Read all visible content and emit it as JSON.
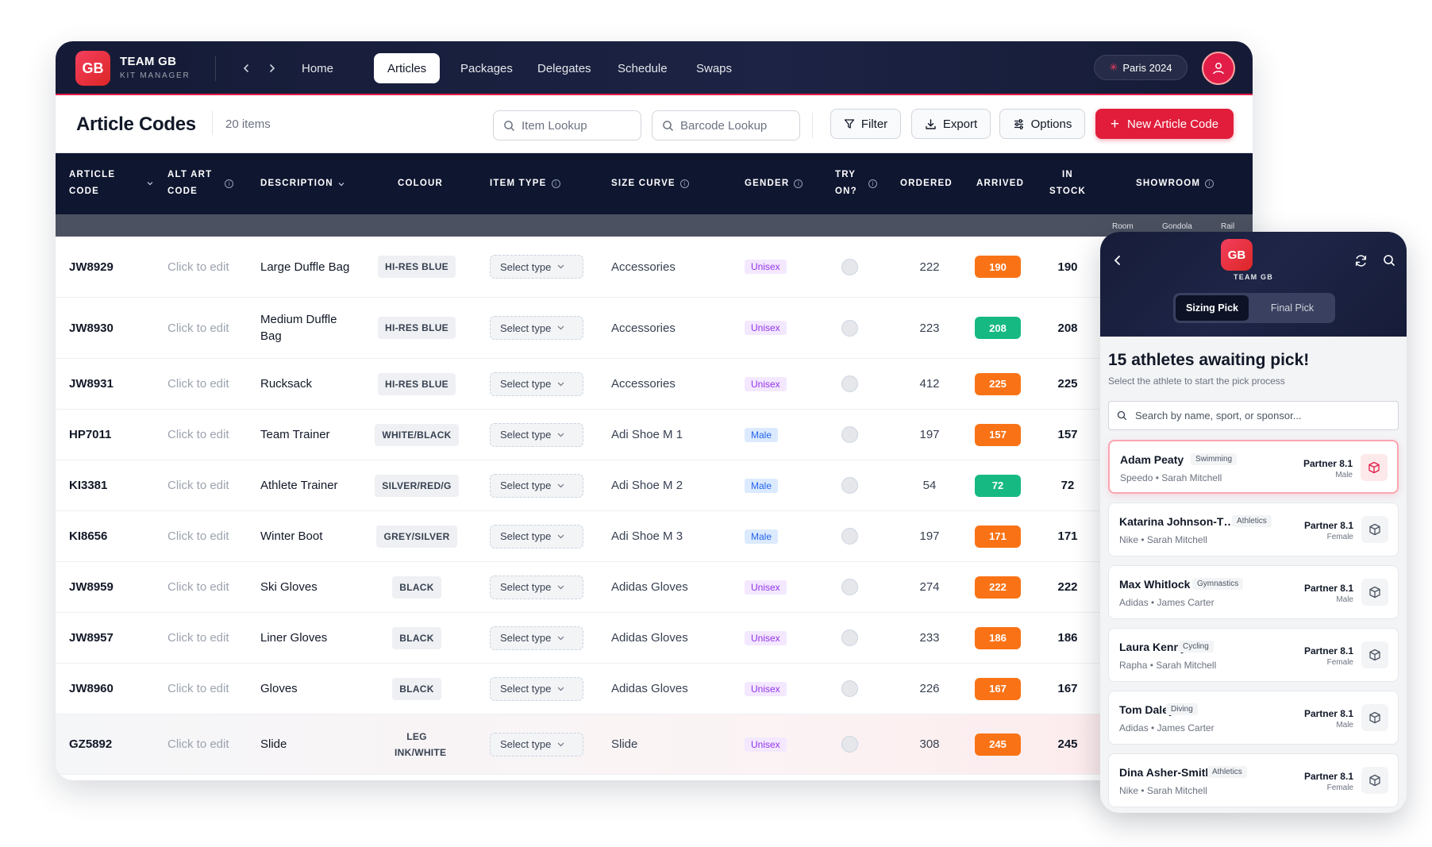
{
  "app": {
    "logo_text": "GB",
    "brand_title": "TEAM GB",
    "brand_subtitle": "KIT MANAGER",
    "nav": [
      {
        "label": "Home"
      },
      {
        "label": "Articles"
      },
      {
        "label": "Packages"
      },
      {
        "label": "Delegates"
      },
      {
        "label": "Schedule"
      },
      {
        "label": "Swaps"
      }
    ],
    "active_nav": "Articles",
    "event": "Paris 2024",
    "accent_color": "#e11d3b"
  },
  "page": {
    "title": "Article Codes",
    "count": "20 items",
    "item_lookup_placeholder": "Item Lookup",
    "barcode_lookup_placeholder": "Barcode Lookup",
    "filter_label": "Filter",
    "export_label": "Export",
    "options_label": "Options",
    "new_label": "New Article Code"
  },
  "table": {
    "headers": {
      "article_code": [
        "ARTICLE",
        "CODE"
      ],
      "alt_art_code": [
        "ALT ART",
        "CODE"
      ],
      "description": "DESCRIPTION",
      "colour": "COLOUR",
      "item_type": "ITEM TYPE",
      "size_curve": "SIZE CURVE",
      "gender": "GENDER",
      "try_on": [
        "TRY",
        "ON?"
      ],
      "ordered": "ORDERED",
      "arrived": "ARRIVED",
      "in_stock": [
        "IN",
        "STOCK"
      ],
      "showroom": "SHOWROOM"
    },
    "showroom_sub": [
      "Room",
      "Gondola",
      "Rail"
    ],
    "rows": [
      {
        "code": "JW8929",
        "alt": "Click to edit",
        "description": "Large Duffle Bag",
        "colour": "HI-RES BLUE",
        "item_type": "Select type",
        "size_curve": "Accessories",
        "gender": "Unisex",
        "ordered": "222",
        "arrived": "190",
        "arrived_status": "orange",
        "in_stock": "190"
      },
      {
        "code": "JW8930",
        "alt": "Click to edit",
        "description": "Medium Duffle Bag",
        "colour": "HI-RES BLUE",
        "item_type": "Select type",
        "size_curve": "Accessories",
        "gender": "Unisex",
        "ordered": "223",
        "arrived": "208",
        "arrived_status": "green",
        "in_stock": "208"
      },
      {
        "code": "JW8931",
        "alt": "Click to edit",
        "description": "Rucksack",
        "colour": "HI-RES BLUE",
        "item_type": "Select type",
        "size_curve": "Accessories",
        "gender": "Unisex",
        "ordered": "412",
        "arrived": "225",
        "arrived_status": "orange",
        "in_stock": "225"
      },
      {
        "code": "HP7011",
        "alt": "Click to edit",
        "description": "Team Trainer",
        "colour": "WHITE/BLACK",
        "item_type": "Select type",
        "size_curve": "Adi Shoe M 1",
        "gender": "Male",
        "ordered": "197",
        "arrived": "157",
        "arrived_status": "orange",
        "in_stock": "157"
      },
      {
        "code": "KI3381",
        "alt": "Click to edit",
        "description": "Athlete Trainer",
        "colour": "SILVER/RED/G",
        "item_type": "Select type",
        "size_curve": "Adi Shoe M 2",
        "gender": "Male",
        "ordered": "54",
        "arrived": "72",
        "arrived_status": "green",
        "in_stock": "72"
      },
      {
        "code": "KI8656",
        "alt": "Click to edit",
        "description": "Winter Boot",
        "colour": "GREY/SILVER",
        "item_type": "Select type",
        "size_curve": "Adi Shoe M 3",
        "gender": "Male",
        "ordered": "197",
        "arrived": "171",
        "arrived_status": "orange",
        "in_stock": "171"
      },
      {
        "code": "JW8959",
        "alt": "Click to edit",
        "description": "Ski Gloves",
        "colour": "BLACK",
        "item_type": "Select type",
        "size_curve": "Adidas Gloves",
        "gender": "Unisex",
        "ordered": "274",
        "arrived": "222",
        "arrived_status": "orange",
        "in_stock": "222"
      },
      {
        "code": "JW8957",
        "alt": "Click to edit",
        "description": "Liner Gloves",
        "colour": "BLACK",
        "item_type": "Select type",
        "size_curve": "Adidas Gloves",
        "gender": "Unisex",
        "ordered": "233",
        "arrived": "186",
        "arrived_status": "orange",
        "in_stock": "186"
      },
      {
        "code": "JW8960",
        "alt": "Click to edit",
        "description": "Gloves",
        "colour": "BLACK",
        "item_type": "Select type",
        "size_curve": "Adidas Gloves",
        "gender": "Unisex",
        "ordered": "226",
        "arrived": "167",
        "arrived_status": "orange",
        "in_stock": "167"
      },
      {
        "code": "GZ5892",
        "alt": "Click to edit",
        "description": "Slide",
        "colour": "LEG INK/WHITE",
        "item_type": "Select type",
        "size_curve": "Slide",
        "gender": "Unisex",
        "ordered": "308",
        "arrived": "245",
        "arrived_status": "orange",
        "in_stock": "245"
      }
    ]
  },
  "mobile": {
    "logo_text": "GB",
    "team_label": "TEAM GB",
    "tabs": [
      "Sizing Pick",
      "Final Pick"
    ],
    "active_tab": "Sizing Pick",
    "title": "15 athletes awaiting pick!",
    "subtitle": "Select the athlete to start the pick process",
    "search_placeholder": "Search by name, sport, or sponsor...",
    "athletes": [
      {
        "name": "Adam Peaty",
        "sport": "Swimming",
        "meta": "Speedo • Sarah Mitchell",
        "partner": "Partner 8.1",
        "gender": "Male",
        "selected": true
      },
      {
        "name": "Katarina Johnson-Th...",
        "sport": "Athletics",
        "meta": "Nike • Sarah Mitchell",
        "partner": "Partner 8.1",
        "gender": "Female",
        "selected": false
      },
      {
        "name": "Max Whitlock",
        "sport": "Gymnastics",
        "meta": "Adidas • James Carter",
        "partner": "Partner 8.1",
        "gender": "Male",
        "selected": false
      },
      {
        "name": "Laura Kenny",
        "sport": "Cycling",
        "meta": "Rapha • Sarah Mitchell",
        "partner": "Partner 8.1",
        "gender": "Female",
        "selected": false
      },
      {
        "name": "Tom Daley",
        "sport": "Diving",
        "meta": "Adidas • James Carter",
        "partner": "Partner 8.1",
        "gender": "Male",
        "selected": false
      },
      {
        "name": "Dina Asher-Smith",
        "sport": "Athletics",
        "meta": "Nike • Sarah Mitchell",
        "partner": "Partner 8.1",
        "gender": "Female",
        "selected": false
      }
    ]
  }
}
